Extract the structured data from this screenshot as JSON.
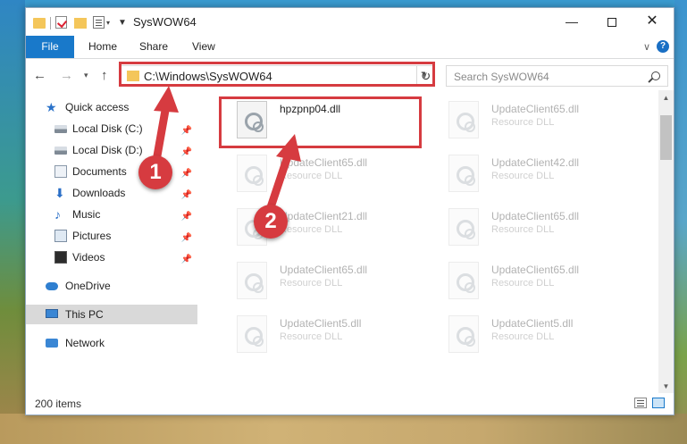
{
  "window": {
    "title": "SysWOW64",
    "min_glyph": "—",
    "close_glyph": "✕"
  },
  "ribbon": {
    "tabs": [
      "File",
      "Home",
      "Share",
      "View"
    ],
    "help": "?"
  },
  "nav": {
    "address": "C:\\Windows\\SysWOW64",
    "search_placeholder": "Search SysWOW64"
  },
  "sidebar": {
    "items": [
      {
        "label": "Quick access",
        "icon": "star-icon"
      },
      {
        "label": "Local Disk (C:)",
        "icon": "drive-icon"
      },
      {
        "label": "Local Disk (D:)",
        "icon": "drive-icon"
      },
      {
        "label": "Documents",
        "icon": "documents-icon"
      },
      {
        "label": "Downloads",
        "icon": "download-icon"
      },
      {
        "label": "Music",
        "icon": "music-icon"
      },
      {
        "label": "Pictures",
        "icon": "pictures-icon"
      },
      {
        "label": "Videos",
        "icon": "videos-icon"
      },
      {
        "label": "OneDrive",
        "icon": "cloud-icon"
      },
      {
        "label": "This PC",
        "icon": "computer-icon"
      },
      {
        "label": "Network",
        "icon": "network-icon"
      }
    ]
  },
  "files": [
    {
      "name": "hpzpnp04.dll",
      "type": ""
    },
    {
      "name": "UpdateClient65.dll",
      "type": "Resource DLL"
    },
    {
      "name": "UpdateClient65.dll",
      "type": "Resource DLL"
    },
    {
      "name": "UpdateClient42.dll",
      "type": "Resource DLL"
    },
    {
      "name": "UpdateClient21.dll",
      "type": "Resource DLL"
    },
    {
      "name": "UpdateClient65.dll",
      "type": "Resource DLL"
    },
    {
      "name": "UpdateClient65.dll",
      "type": "Resource DLL"
    },
    {
      "name": "UpdateClient65.dll",
      "type": "Resource DLL"
    },
    {
      "name": "UpdateClient5.dll",
      "type": "Resource DLL"
    },
    {
      "name": "UpdateClient5.dll",
      "type": "Resource DLL"
    }
  ],
  "status": {
    "item_count": "200 items"
  },
  "annotations": {
    "step1": "1",
    "step2": "2",
    "accent": "#d63b40"
  }
}
